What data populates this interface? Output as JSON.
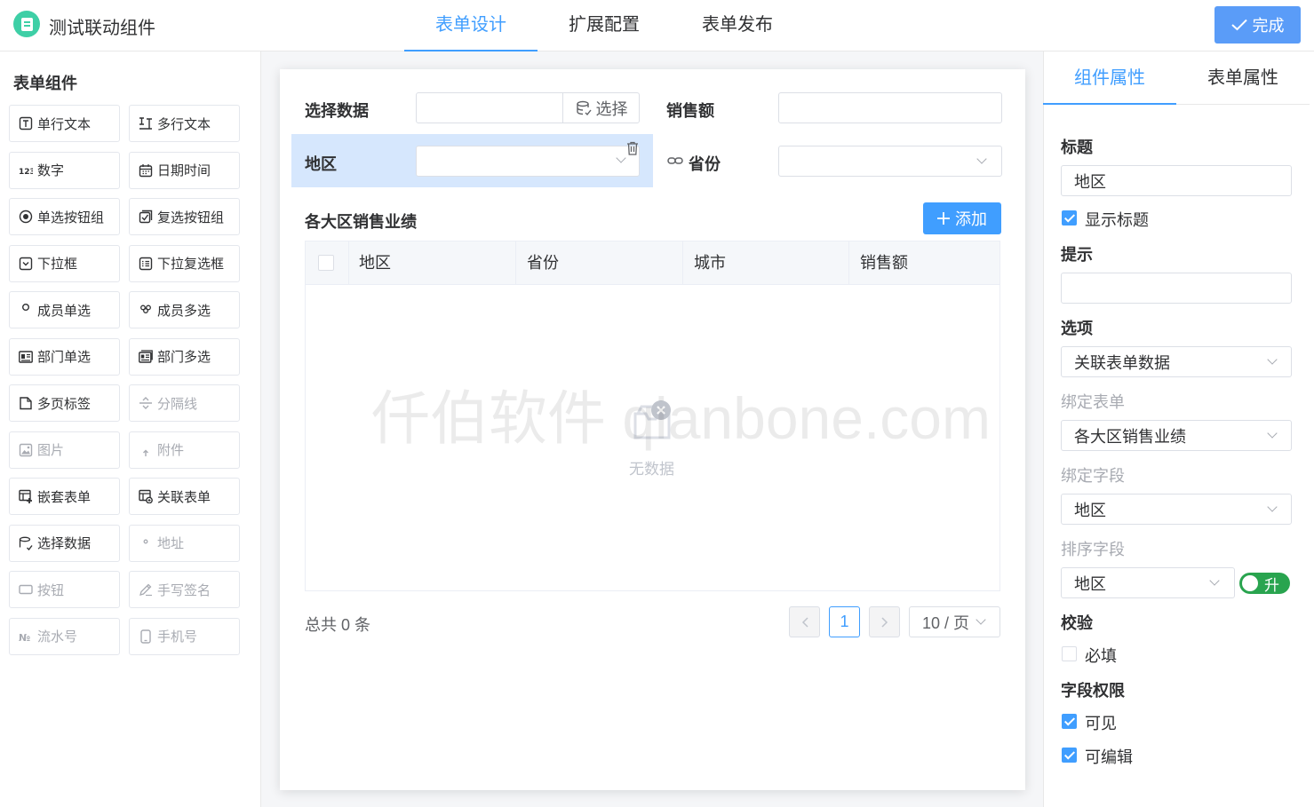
{
  "header": {
    "app_title": "测试联动组件",
    "tabs": [
      {
        "label": "表单设计",
        "active": true
      },
      {
        "label": "扩展配置",
        "active": false
      },
      {
        "label": "表单发布",
        "active": false
      }
    ],
    "done_label": "完成",
    "accent_color": "#409eff"
  },
  "left_panel": {
    "title": "表单组件",
    "components": [
      {
        "label": "单行文本",
        "icon": "text-box-icon",
        "enabled": true
      },
      {
        "label": "多行文本",
        "icon": "multiline-text-icon",
        "enabled": true
      },
      {
        "label": "数字",
        "icon": "number-123-icon",
        "enabled": true
      },
      {
        "label": "日期时间",
        "icon": "calendar-icon",
        "enabled": true
      },
      {
        "label": "单选按钮组",
        "icon": "radio-icon",
        "enabled": true
      },
      {
        "label": "复选按钮组",
        "icon": "checkbox-group-icon",
        "enabled": true
      },
      {
        "label": "下拉框",
        "icon": "dropdown-icon",
        "enabled": true
      },
      {
        "label": "下拉复选框",
        "icon": "dropdown-multi-icon",
        "enabled": true
      },
      {
        "label": "成员单选",
        "icon": "user-icon",
        "enabled": true
      },
      {
        "label": "成员多选",
        "icon": "users-icon",
        "enabled": true
      },
      {
        "label": "部门单选",
        "icon": "department-icon",
        "enabled": true
      },
      {
        "label": "部门多选",
        "icon": "departments-icon",
        "enabled": true
      },
      {
        "label": "多页标签",
        "icon": "tabs-icon",
        "enabled": true
      },
      {
        "label": "分隔线",
        "icon": "divider-icon",
        "enabled": false
      },
      {
        "label": "图片",
        "icon": "image-icon",
        "enabled": false
      },
      {
        "label": "附件",
        "icon": "upload-icon",
        "enabled": false
      },
      {
        "label": "嵌套表单",
        "icon": "nested-table-icon",
        "enabled": true
      },
      {
        "label": "关联表单",
        "icon": "linked-form-icon",
        "enabled": true
      },
      {
        "label": "选择数据",
        "icon": "database-icon",
        "enabled": true
      },
      {
        "label": "地址",
        "icon": "location-pin-icon",
        "enabled": false
      },
      {
        "label": "按钮",
        "icon": "button-icon",
        "enabled": false
      },
      {
        "label": "手写签名",
        "icon": "signature-icon",
        "enabled": false
      },
      {
        "label": "流水号",
        "icon": "serial-number-icon",
        "enabled": false
      },
      {
        "label": "手机号",
        "icon": "phone-icon",
        "enabled": false
      }
    ]
  },
  "canvas": {
    "field_select_data": {
      "label": "选择数据",
      "button_label": "选择"
    },
    "field_sales": {
      "label": "销售额"
    },
    "field_region": {
      "label": "地区"
    },
    "field_province": {
      "label": "省份"
    },
    "subform": {
      "title": "各大区销售业绩",
      "add_label": "添加",
      "columns": [
        "地区",
        "省份",
        "城市",
        "销售额"
      ],
      "rows": [],
      "empty_text": "无数据"
    },
    "watermark": "仟伯软件 qianbone.com",
    "pagination": {
      "total_text": "总共 0 条",
      "current_page": "1",
      "page_size": "10 / 页"
    }
  },
  "right_panel": {
    "tabs": [
      {
        "label": "组件属性",
        "active": true
      },
      {
        "label": "表单属性",
        "active": false
      }
    ],
    "title_label": "标题",
    "title_value": "地区",
    "show_title_label": "显示标题",
    "show_title_checked": true,
    "hint_label": "提示",
    "hint_value": "",
    "options_label": "选项",
    "options_value": "关联表单数据",
    "bind_form_label": "绑定表单",
    "bind_form_value": "各大区销售业绩",
    "bind_field_label": "绑定字段",
    "bind_field_value": "地区",
    "sort_field_label": "排序字段",
    "sort_field_value": "地区",
    "sort_switch_label": "升",
    "validation_label": "校验",
    "required_label": "必填",
    "required_checked": false,
    "permission_label": "字段权限",
    "visible_label": "可见",
    "visible_checked": true,
    "editable_label": "可编辑",
    "editable_checked": true
  }
}
